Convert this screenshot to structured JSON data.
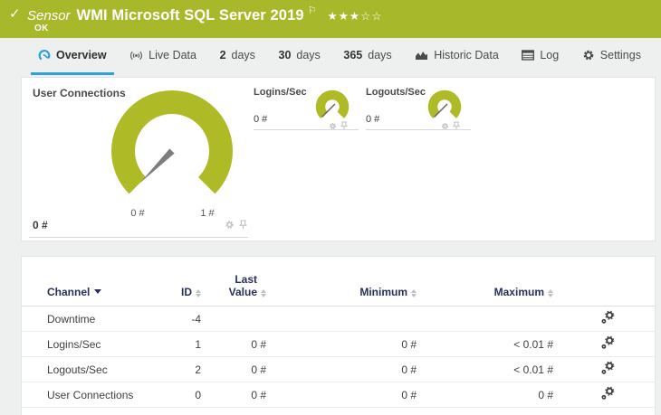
{
  "header": {
    "check": "✓",
    "kind": "Sensor",
    "title": "WMI Microsoft SQL Server 2019",
    "flag": "⚐",
    "stars_filled": "★★★",
    "stars_empty": "☆☆",
    "status": "OK"
  },
  "tabs": [
    {
      "label": "Overview",
      "active": true
    },
    {
      "label": "Live Data"
    },
    {
      "num": "2",
      "label": "days"
    },
    {
      "num": "30",
      "label": "days"
    },
    {
      "num": "365",
      "label": "days"
    },
    {
      "label": "Historic Data"
    },
    {
      "label": "Log"
    },
    {
      "label": "Settings"
    }
  ],
  "overview": {
    "main_gauge": {
      "title": "User Connections",
      "value": "0 #",
      "scale_min": "0 #",
      "scale_max": "1 #"
    },
    "mini_gauges": [
      {
        "title": "Logins/Sec",
        "value": "0 #"
      },
      {
        "title": "Logouts/Sec",
        "value": "0 #"
      }
    ]
  },
  "channel_table": {
    "headers": {
      "channel": "Channel",
      "id": "ID",
      "last_value": "Last Value",
      "minimum": "Minimum",
      "maximum": "Maximum"
    },
    "rows": [
      {
        "channel": "Downtime",
        "id": "-4",
        "last_value": "",
        "minimum": "",
        "maximum": ""
      },
      {
        "channel": "Logins/Sec",
        "id": "1",
        "last_value": "0 #",
        "minimum": "0 #",
        "maximum": "< 0.01 #"
      },
      {
        "channel": "Logouts/Sec",
        "id": "2",
        "last_value": "0 #",
        "minimum": "0 #",
        "maximum": "< 0.01 #"
      },
      {
        "channel": "User Connections",
        "id": "0",
        "last_value": "0 #",
        "minimum": "0 #",
        "maximum": "0 #"
      }
    ]
  },
  "colors": {
    "ok_green": "#a8b82b",
    "gauge_green": "#aebb27",
    "accent_blue": "#2aa3dc",
    "header_navy": "#26305a"
  }
}
